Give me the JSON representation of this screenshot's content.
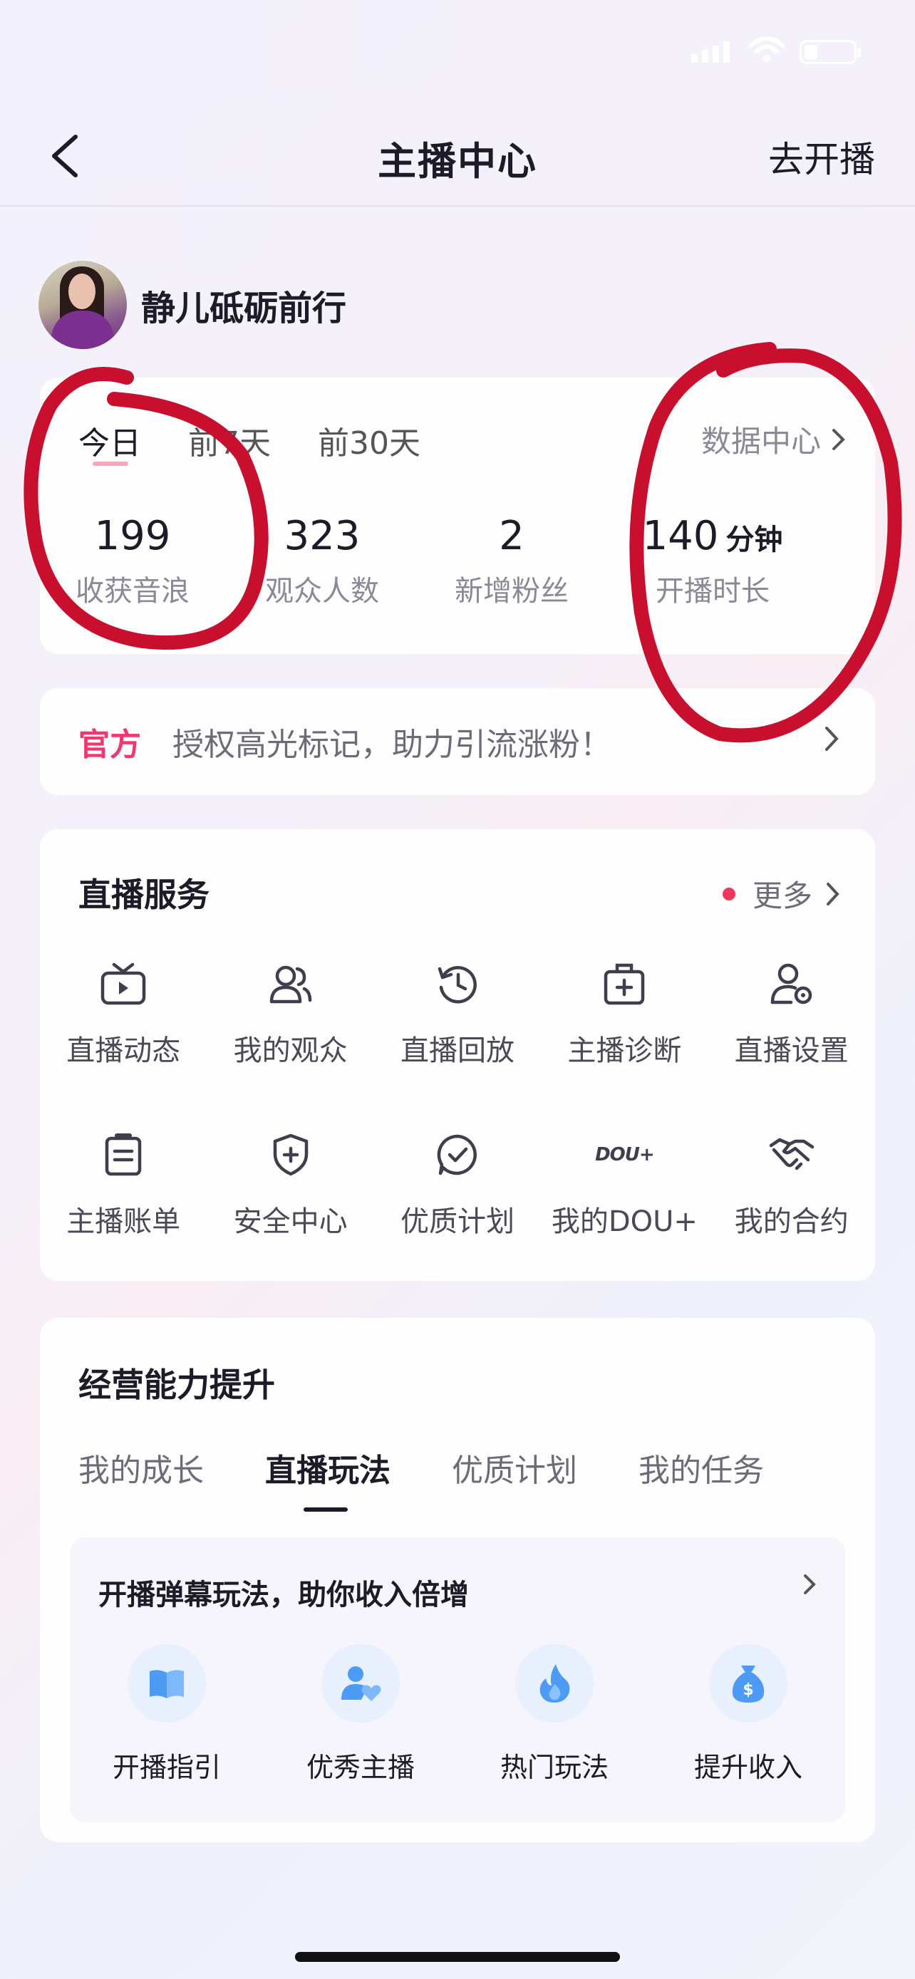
{
  "nav": {
    "title": "主播中心",
    "go_live": "去开播"
  },
  "profile": {
    "name": "静儿砥砺前行"
  },
  "stats": {
    "tabs": [
      "今日",
      "前7天",
      "前30天"
    ],
    "active_tab": "今日",
    "data_center": "数据中心",
    "items": [
      {
        "value": "199",
        "unit": "",
        "label": "收获音浪"
      },
      {
        "value": "323",
        "unit": "",
        "label": "观众人数"
      },
      {
        "value": "2",
        "unit": "",
        "label": "新增粉丝"
      },
      {
        "value": "140",
        "unit": "分钟",
        "label": "开播时长"
      }
    ]
  },
  "promo": {
    "tag": "官方",
    "text": "授权高光标记，助力引流涨粉！"
  },
  "services": {
    "title": "直播服务",
    "more": "更多",
    "items": [
      {
        "label": "直播动态",
        "icon": "tv-icon"
      },
      {
        "label": "我的观众",
        "icon": "users-icon"
      },
      {
        "label": "直播回放",
        "icon": "history-icon"
      },
      {
        "label": "主播诊断",
        "icon": "medical-kit-icon"
      },
      {
        "label": "直播设置",
        "icon": "user-settings-icon"
      },
      {
        "label": "主播账单",
        "icon": "clipboard-icon"
      },
      {
        "label": "安全中心",
        "icon": "shield-plus-icon"
      },
      {
        "label": "优质计划",
        "icon": "check-circle-icon"
      },
      {
        "label": "我的DOU+",
        "icon": "dou-plus-icon",
        "icon_text": "DOU+"
      },
      {
        "label": "我的合约",
        "icon": "handshake-icon"
      }
    ]
  },
  "growth": {
    "title": "经营能力提升",
    "tabs": [
      "我的成长",
      "直播玩法",
      "优质计划",
      "我的任务"
    ],
    "active_tab": "直播玩法",
    "panel_title": "开播弹幕玩法，助你收入倍增",
    "tools": [
      {
        "label": "开播指引",
        "icon": "book-icon"
      },
      {
        "label": "优秀主播",
        "icon": "user-heart-icon"
      },
      {
        "label": "热门玩法",
        "icon": "flame-icon"
      },
      {
        "label": "提升收入",
        "icon": "money-bag-icon"
      }
    ]
  },
  "colors": {
    "accent_red": "#f0386e",
    "annotation": "#c8102e",
    "icon_blue": "#4c9bf5"
  }
}
